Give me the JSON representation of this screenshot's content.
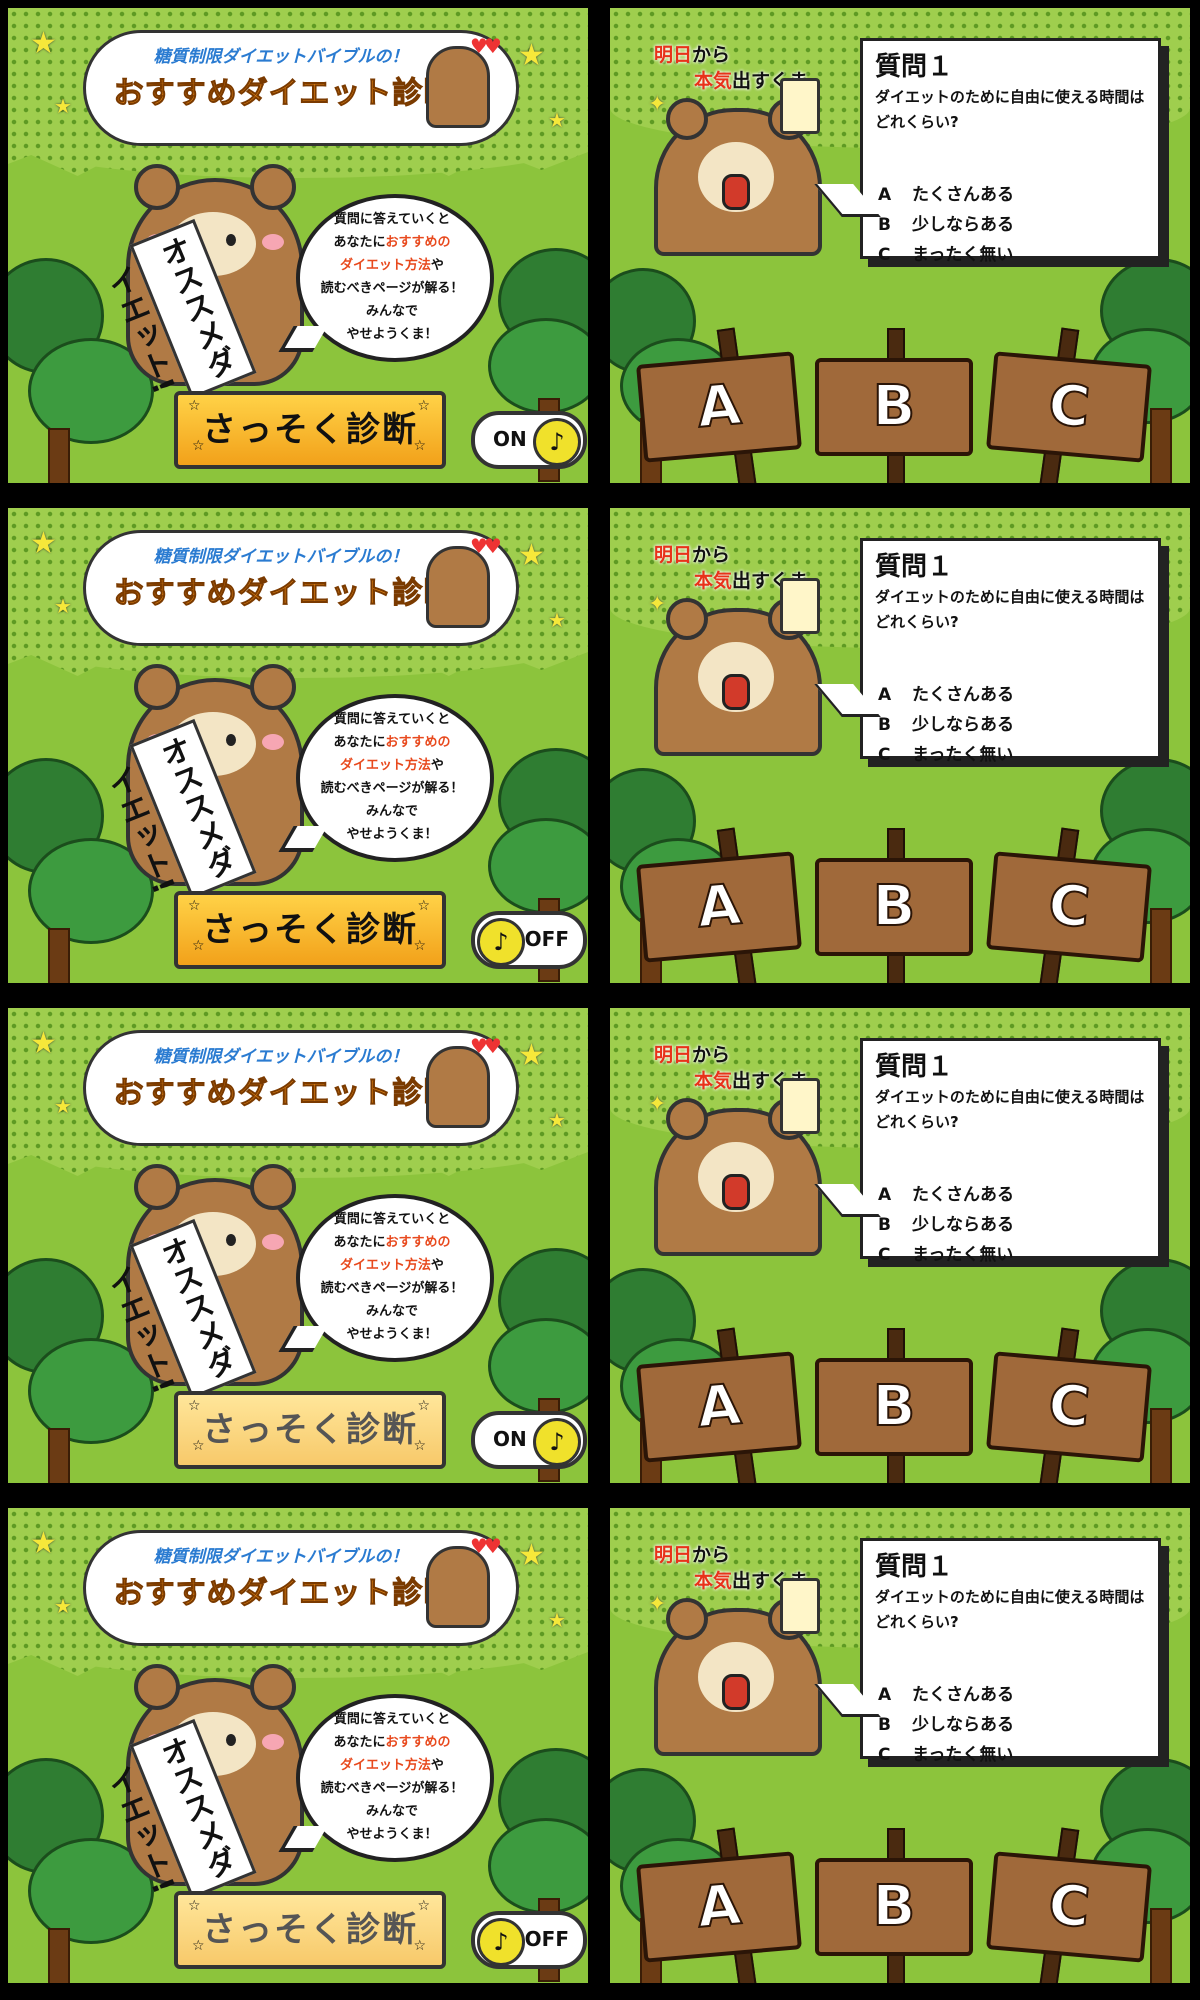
{
  "title": {
    "subtitle": "糖質制限ダイエットバイブルの！",
    "main": "おすすめダイエット診断"
  },
  "bear_sash": "オススメダイエット!",
  "speech": {
    "line1": "質問に答えていくと",
    "line2_pre": "あなたに",
    "line2_hl": "おすすめの",
    "line3_hl": "ダイエット方法",
    "line3_post": "や",
    "line4": "読むべきページが解る！",
    "line5": "みんなで",
    "line6": "やせようくま！"
  },
  "start_button": "さっそく診断",
  "sound_toggle": {
    "on_label": "ON",
    "off_label": "OFF",
    "icon": "♪"
  },
  "quiz": {
    "remark_red1": "明日",
    "remark_black1": "から",
    "remark_red2": "本気",
    "remark_black2": "出すくま。",
    "question_title": "質問１",
    "question_text": "ダイエットのために自由に使える時間はどれくらい?",
    "options": [
      {
        "key": "A",
        "label": "たくさんある"
      },
      {
        "key": "B",
        "label": "少しならある"
      },
      {
        "key": "C",
        "label": "まったく無い"
      }
    ],
    "signs": [
      "A",
      "B",
      "C"
    ]
  },
  "rows": [
    {
      "toggle_state": "on",
      "button_faded": false
    },
    {
      "toggle_state": "off",
      "button_faded": false
    },
    {
      "toggle_state": "on",
      "button_faded": true
    },
    {
      "toggle_state": "off",
      "button_faded": true
    }
  ],
  "colors": {
    "grass": "#8cc43c",
    "title_orange": "#f18e16",
    "title_blue": "#2a7bd1",
    "highlight_red": "#e8491d",
    "button_yellow": "#f2a11a",
    "bear_brown": "#b07a45"
  }
}
